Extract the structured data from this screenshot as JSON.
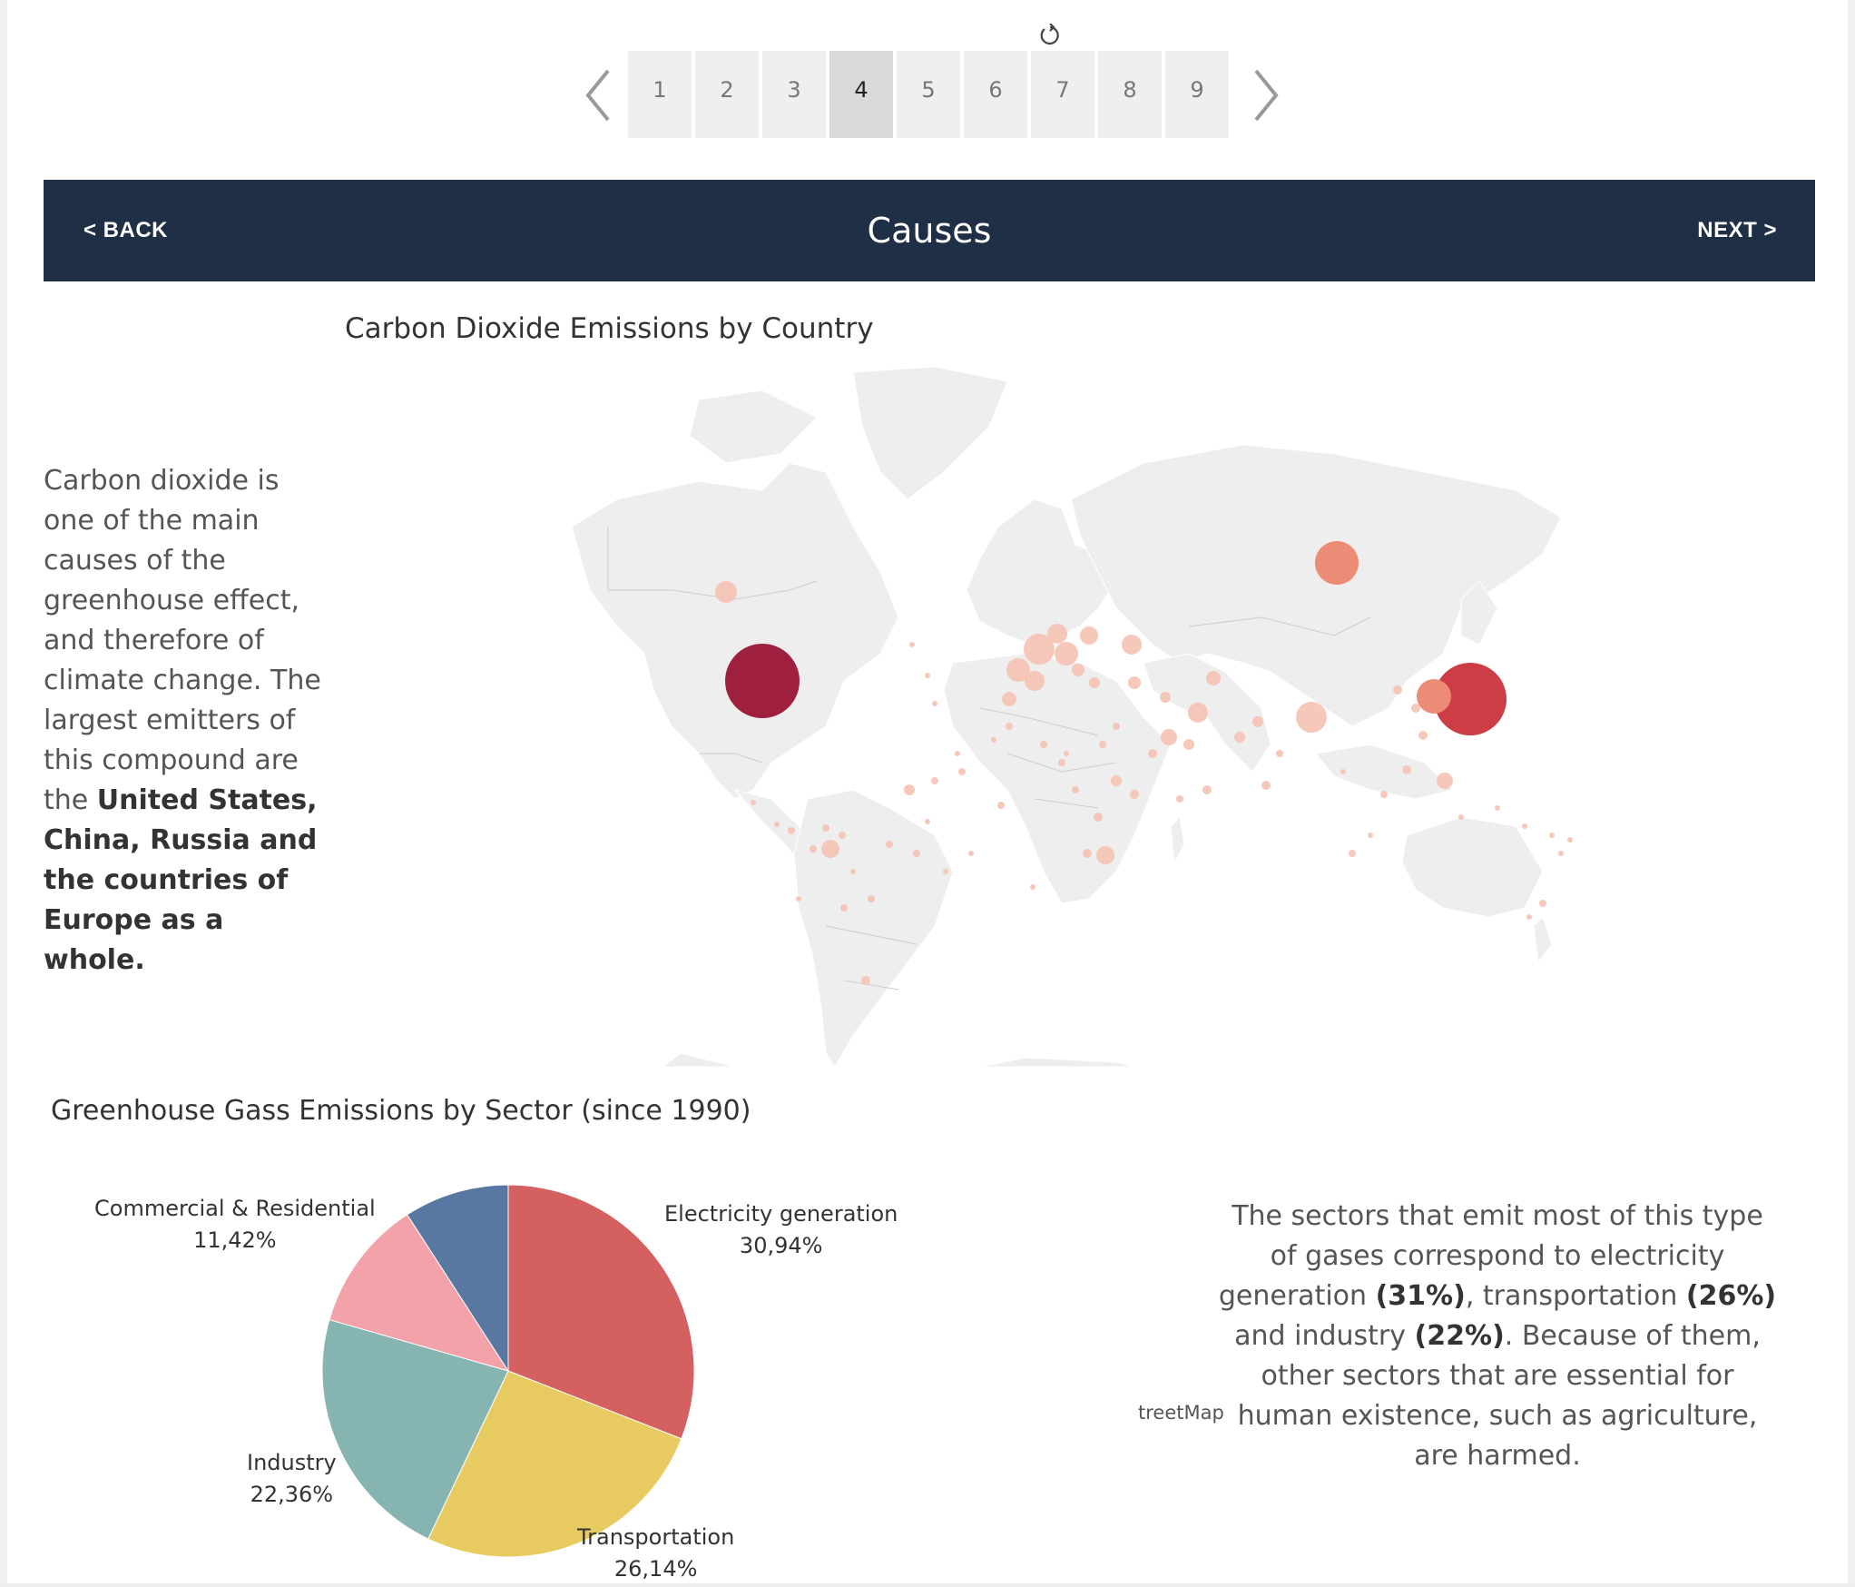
{
  "pager": {
    "pages": [
      "1",
      "2",
      "3",
      "4",
      "5",
      "6",
      "7",
      "8",
      "9"
    ],
    "active": "4",
    "prev_icon": "chevron-left-icon",
    "next_icon": "chevron-right-icon",
    "refresh_icon": "refresh-icon"
  },
  "header": {
    "back_label": "< BACK",
    "title": "Causes",
    "next_label": "NEXT >",
    "bg_color": "#1f2f45"
  },
  "map": {
    "title": "Carbon Dioxide Emissions by Country",
    "credit": "treetMap",
    "land_color": "#eeeeee",
    "bubble_scale": [
      "#f5c2b3",
      "#ec8b76",
      "#cc3d45",
      "#9e203e"
    ]
  },
  "left_text": {
    "part1": "Carbon dioxide is one of the main causes of the greenhouse effect, and therefore of climate change. The largest emitters of this compound are the ",
    "bold": "United States, China, Russia and the countries of Europe as a whole."
  },
  "chart_data": {
    "type": "pie",
    "title": "Greenhouse Gass Emissions by Sector (since 1990)",
    "slices": [
      {
        "name": "Electricity generation",
        "label": "30,94%",
        "value": 30.94,
        "color": "#d4605f"
      },
      {
        "name": "Transportation",
        "label": "26,14%",
        "value": 26.14,
        "color": "#e8cb60"
      },
      {
        "name": "Industry",
        "label": "22,36%",
        "value": 22.36,
        "color": "#86b4b0"
      },
      {
        "name": "Commercial & Residential",
        "label": "11,42%",
        "value": 11.42,
        "color": "#f2a2a8"
      },
      {
        "name": "",
        "label": "",
        "value": 9.14,
        "color": "#5878a2"
      }
    ]
  },
  "right_text": {
    "t1": "The sectors that emit most of this type of gases correspond to electricity generation ",
    "b1": "(31%)",
    "t2": ", transportation ",
    "b2": "(26%)",
    "t3": " and industry ",
    "b3": "(22%)",
    "t4": ". Because of them, other sectors that are essential for human existence, such as agriculture, are harmed."
  }
}
